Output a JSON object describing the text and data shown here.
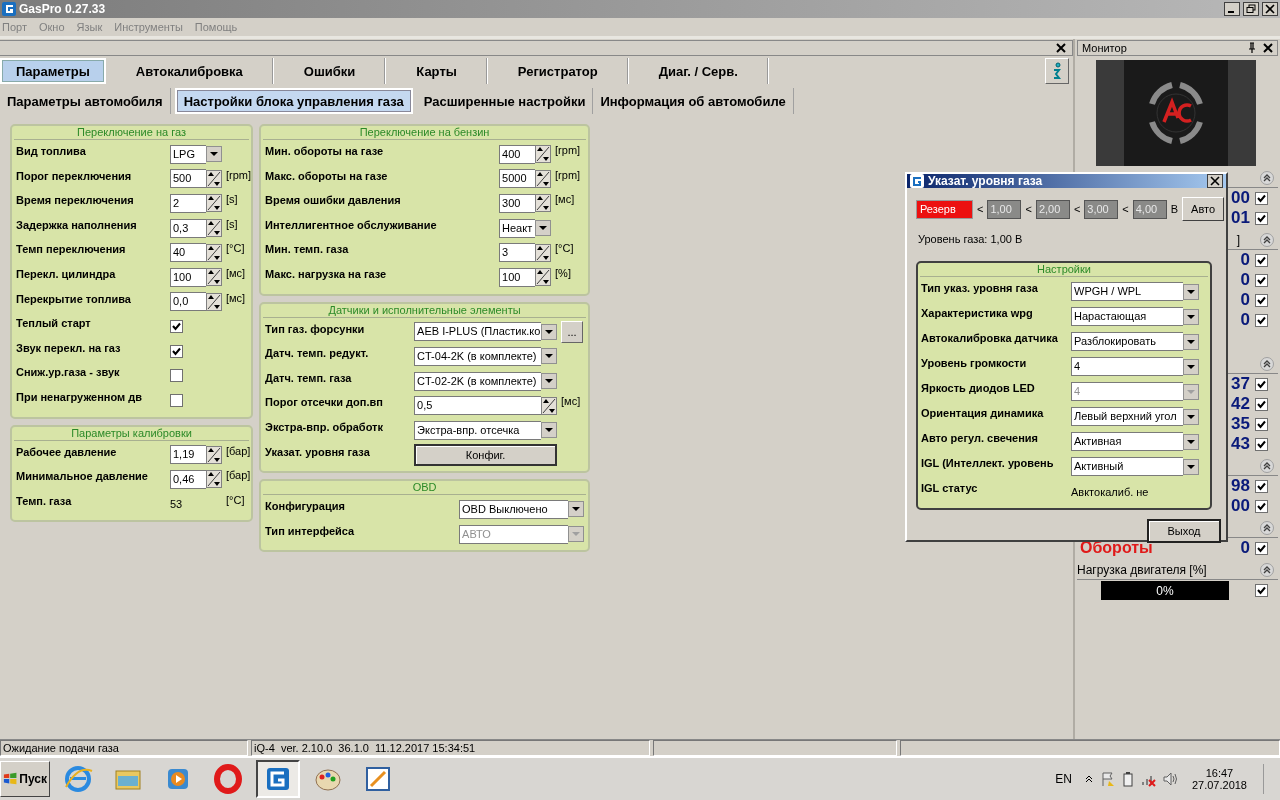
{
  "window": {
    "title": "GasPro 0.27.33"
  },
  "menu": [
    {
      "label": "Порт",
      "disabled": true
    },
    {
      "label": "Окно",
      "disabled": true
    },
    {
      "label": "Язык",
      "disabled": true
    },
    {
      "label": "Инструменты",
      "disabled": true
    },
    {
      "label": "Помощь",
      "disabled": true
    }
  ],
  "tabs": [
    {
      "label": "Параметры",
      "selected": true
    },
    {
      "label": "Автокалибровка",
      "selected": false
    },
    {
      "label": "Ошибки",
      "selected": false
    },
    {
      "label": "Карты",
      "selected": false
    },
    {
      "label": "Регистратор",
      "selected": false
    },
    {
      "label": "Диаг. / Серв.",
      "selected": false
    }
  ],
  "subtabs": [
    {
      "label": "Параметры автомобиля",
      "selected": false
    },
    {
      "label": "Настройки блока управления газа",
      "selected": true
    },
    {
      "label": "Расширенные настройки",
      "selected": false
    },
    {
      "label": "Информация об автомобиле",
      "selected": false
    }
  ],
  "columns": [
    [
      {
        "title": "Переключение на газ",
        "rows": [
          {
            "kind": "select",
            "label": "Вид топлива",
            "value": "LPG"
          },
          {
            "kind": "spin",
            "label": "Порог переключения",
            "value": "500",
            "unit": "[rpm]"
          },
          {
            "kind": "spin",
            "label": "Время переключения",
            "value": "2",
            "unit": "[s]"
          },
          {
            "kind": "spin",
            "label": "Задержка наполнения",
            "value": "0,3",
            "unit": "[s]"
          },
          {
            "kind": "spin",
            "label": "Темп переключения",
            "value": "40",
            "unit": "[°C]"
          },
          {
            "kind": "spin",
            "label": "Перекл. цилиндра",
            "value": "100",
            "unit": "[мс]"
          },
          {
            "kind": "spin",
            "label": "Перекрытие топлива",
            "value": "0,0",
            "unit": "[мс]"
          },
          {
            "kind": "check",
            "label": "Теплый старт",
            "checked": true
          },
          {
            "kind": "check",
            "label": "Звук перекл. на газ",
            "checked": true
          },
          {
            "kind": "check",
            "label": "Сниж.ур.газа - звук",
            "checked": false
          },
          {
            "kind": "check",
            "label": "При ненагруженном дв",
            "checked": false
          }
        ]
      },
      {
        "title": "Параметры калибровки",
        "rows": [
          {
            "kind": "spin",
            "label": "Рабочее давление",
            "value": "1,19",
            "unit": "[бар]"
          },
          {
            "kind": "spin",
            "label": "Минимальное давление",
            "value": "0,46",
            "unit": "[бар]"
          },
          {
            "kind": "text",
            "label": "Темп. газа",
            "value": "53",
            "unit": "[°C]"
          }
        ]
      }
    ],
    [
      {
        "title": "Переключение на бензин",
        "rows": [
          {
            "kind": "spin",
            "label": "Мин. обороты на газе",
            "value": "400",
            "unit": "[rpm]"
          },
          {
            "kind": "spin",
            "label": "Макс. обороты на газе",
            "value": "5000",
            "unit": "[rpm]"
          },
          {
            "kind": "spin",
            "label": "Время ошибки давления",
            "value": "300",
            "unit": "[мс]"
          },
          {
            "kind": "select",
            "label": "Интеллигентное обслуживание",
            "value": "Неакт"
          },
          {
            "kind": "spin",
            "label": "Мин. темп. газа",
            "value": "3",
            "unit": "[°C]"
          },
          {
            "kind": "spin",
            "label": "Макс. нагрузка на газе",
            "value": "100",
            "unit": "[%]"
          }
        ]
      },
      {
        "title": "Датчики и исполнительные элементы",
        "rows": [
          {
            "kind": "select",
            "label": "Тип газ. форсунки",
            "value": "AEB I-PLUS (Пластик.ко",
            "button": "..."
          },
          {
            "kind": "select",
            "label": "Датч. темп. редукт.",
            "value": "CT-04-2K (в комплекте)"
          },
          {
            "kind": "select",
            "label": "Датч. темп. газа",
            "value": "CT-02-2K (в комплекте)"
          },
          {
            "kind": "spin",
            "label": "Порог отсечки доп.вп",
            "value": "0,5",
            "unit": "[мс]"
          },
          {
            "kind": "select",
            "label": "Экстра-впр. обработк",
            "value": "Экстра-впр. отсечка"
          },
          {
            "kind": "button",
            "label": "Указат. уровня газа",
            "value": "Конфиг."
          }
        ]
      },
      {
        "title": "OBD",
        "rows": [
          {
            "kind": "select",
            "label": "Конфигурация",
            "value": "OBD Выключено",
            "disabled": false
          },
          {
            "kind": "select",
            "label": "Тип интерфейса",
            "value": "АВТО",
            "disabled": true
          }
        ]
      }
    ]
  ],
  "monitor": {
    "title": "Монитор",
    "rows": [
      {
        "kind": "section"
      },
      {
        "kind": "value",
        "value": "00",
        "checked": true
      },
      {
        "kind": "value",
        "value": "01",
        "checked": true
      },
      {
        "kind": "section",
        "label": "]"
      },
      {
        "kind": "value",
        "value": "0",
        "checked": true
      },
      {
        "kind": "value",
        "value": "0",
        "checked": true
      },
      {
        "kind": "value",
        "value": "0",
        "checked": true
      },
      {
        "kind": "value",
        "value": "0",
        "checked": true
      },
      {
        "kind": "section"
      },
      {
        "kind": "value",
        "value": "37",
        "checked": true
      },
      {
        "kind": "value",
        "value": "42",
        "checked": true
      },
      {
        "kind": "value",
        "value": "35",
        "checked": true
      },
      {
        "kind": "value",
        "value": "43",
        "checked": true
      },
      {
        "kind": "section"
      },
      {
        "kind": "value",
        "value": "98",
        "checked": true
      },
      {
        "kind": "value",
        "value": "00",
        "checked": true
      },
      {
        "kind": "section"
      },
      {
        "kind": "alert",
        "label": "Обороты",
        "value": "0",
        "checked": true
      },
      {
        "kind": "section",
        "label": "Нагрузка двигателя [%]"
      },
      {
        "kind": "bar",
        "level": 0,
        "reading": "0%",
        "checked": true
      }
    ]
  },
  "dialog": {
    "title": "Указат. уровня газа",
    "indicator": {
      "label": "Резерв",
      "on": true
    },
    "thresholds": [
      {
        "sign": "<",
        "value": "1,00"
      },
      {
        "sign": "<",
        "value": "2,00"
      },
      {
        "sign": "<",
        "value": "3,00"
      },
      {
        "sign": "<",
        "value": "4,00"
      }
    ],
    "unit": "В",
    "auto_button": "Авто",
    "level_text": "Уровень газа: 1,00 В",
    "group_title": "Настройки",
    "rows": [
      {
        "kind": "select",
        "label": "Тип указ. уровня газа",
        "value": "WPGH / WPL",
        "disabled": false
      },
      {
        "kind": "select",
        "label": "Характеристика wpg",
        "value": "Нарастающая",
        "disabled": false
      },
      {
        "kind": "select",
        "label": "Автокалибровка датчика",
        "value": "Разблокировать",
        "disabled": false
      },
      {
        "kind": "select",
        "label": "Уровень громкости",
        "value": "4",
        "disabled": false
      },
      {
        "kind": "select",
        "label": "Яркость диодов LED",
        "value": "4",
        "disabled": true
      },
      {
        "kind": "select",
        "label": "Ориентация динамика",
        "value": "Левый верхний угол",
        "disabled": false
      },
      {
        "kind": "select",
        "label": "Авто регул. свечения",
        "value": "Активная",
        "disabled": false
      },
      {
        "kind": "select",
        "label": "IGL (Интеллект. уровень",
        "value": "Активный",
        "disabled": false
      },
      {
        "kind": "text",
        "label": "IGL статус",
        "value": "Авктокалиб. не",
        "disabled": false
      }
    ],
    "exit_button": "Выход"
  },
  "status_bar": [
    "Ожидание подачи газа",
    "iQ-4  ver. 2.10.0  36.1.0  11.12.2017 15:34:51"
  ],
  "taskbar": {
    "start": "Пуск",
    "apps": [
      {
        "kind": "browser",
        "selected": false
      },
      {
        "kind": "folder",
        "selected": false
      },
      {
        "kind": "player",
        "selected": false
      },
      {
        "kind": "opera",
        "selected": false
      },
      {
        "kind": "gaspro",
        "selected": true
      },
      {
        "kind": "paint",
        "selected": false
      },
      {
        "kind": "editor",
        "selected": false
      }
    ],
    "language": "EN",
    "time": "16:47",
    "date": "27.07.2018"
  }
}
